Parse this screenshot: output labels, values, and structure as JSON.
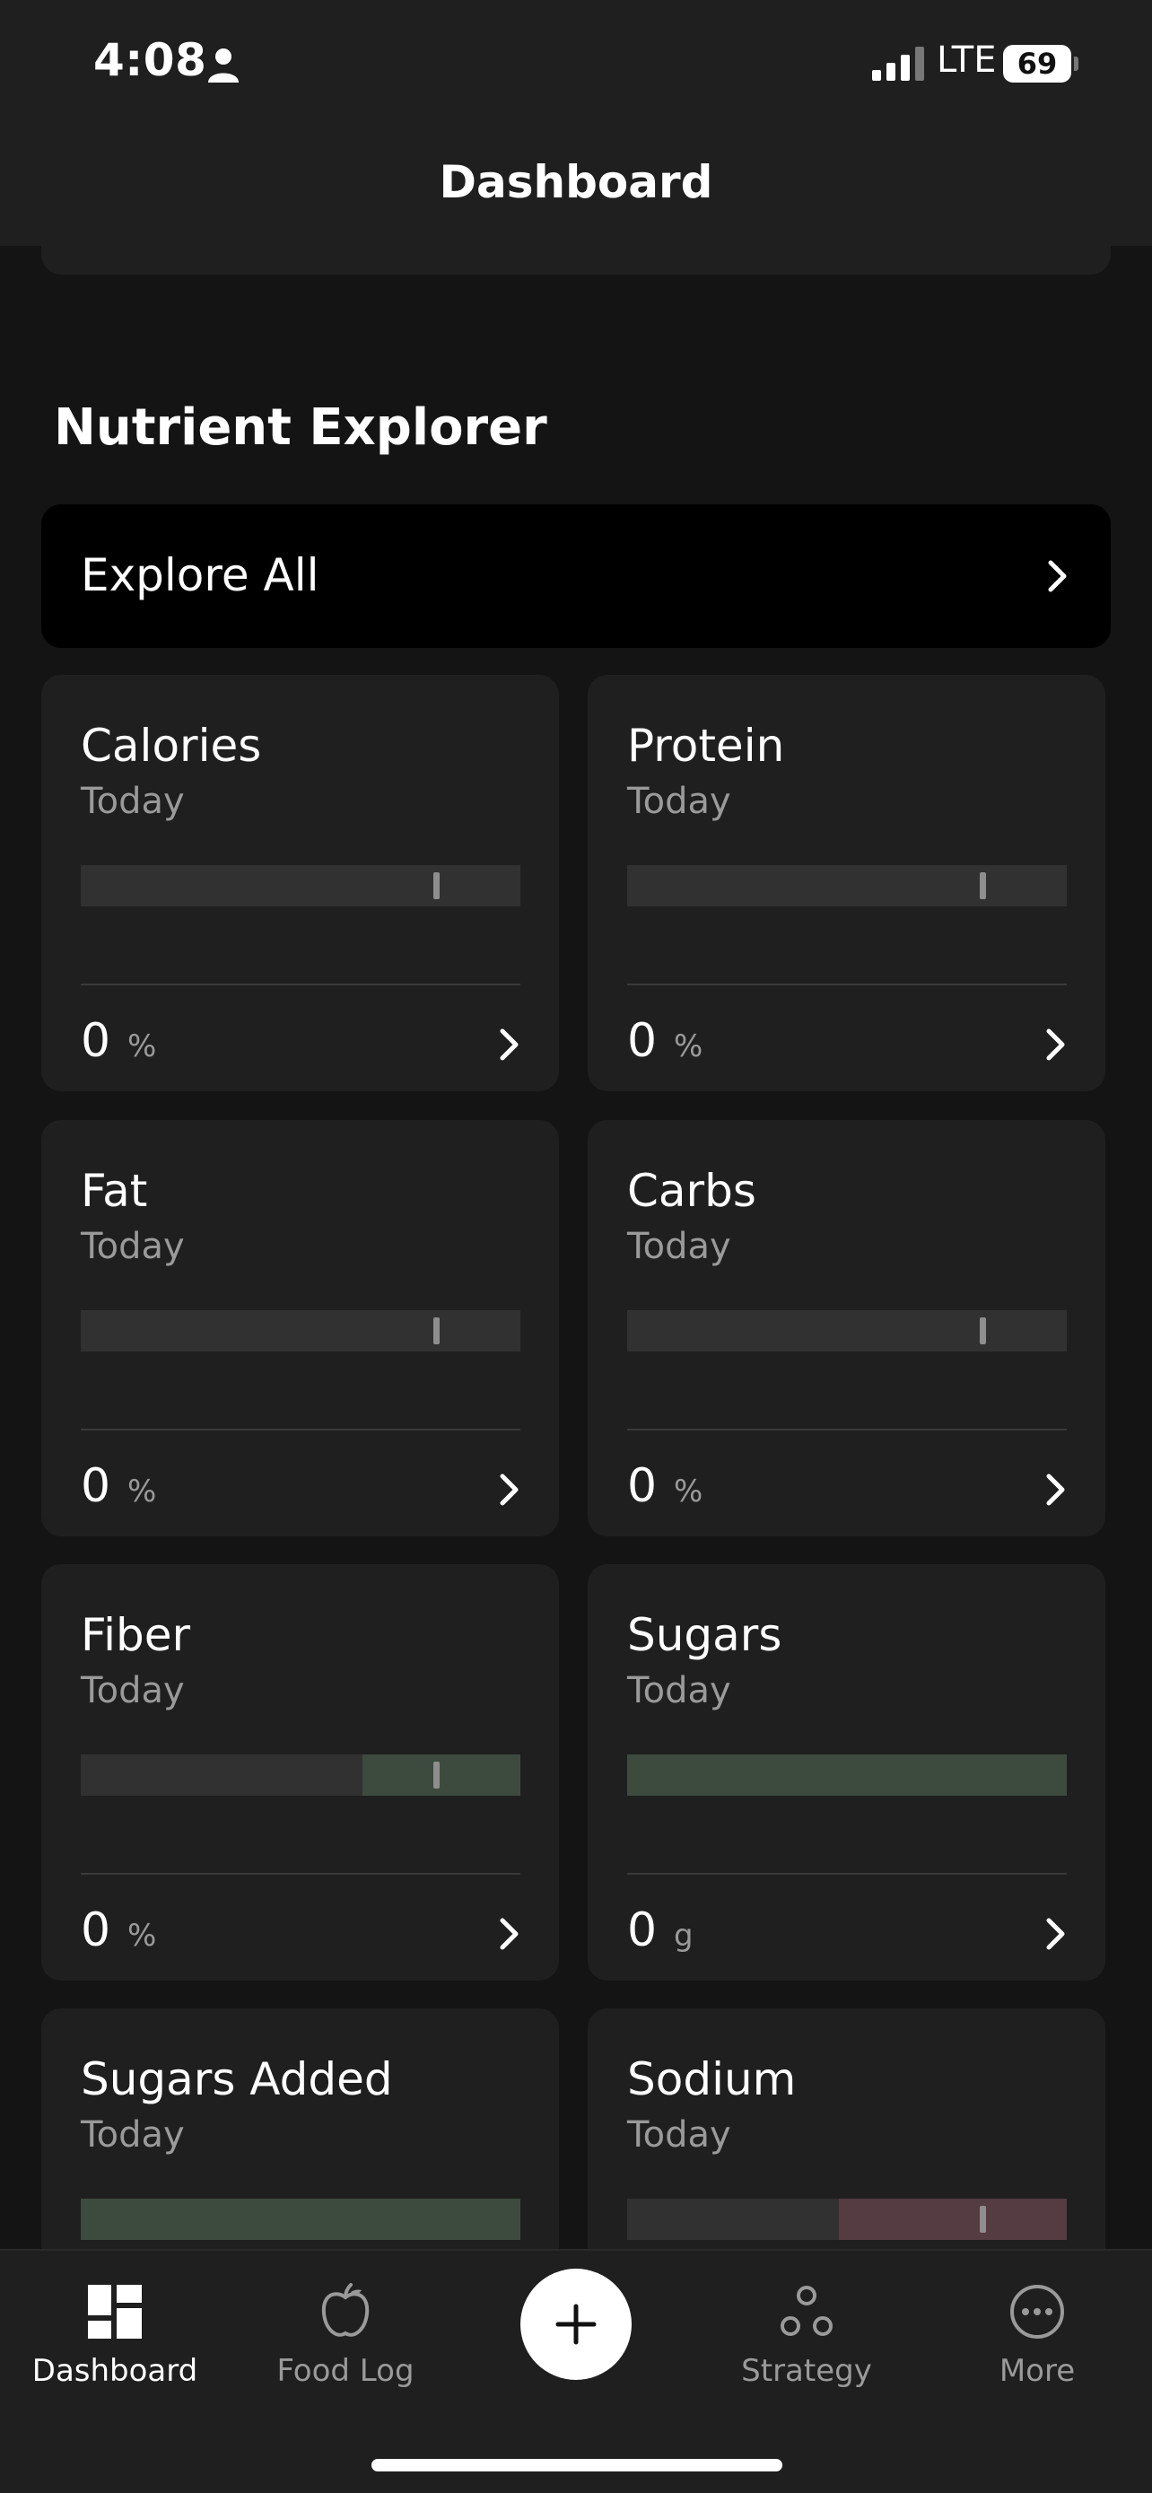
{
  "status_bar": {
    "time": "4:08",
    "network": "LTE",
    "battery": "69"
  },
  "header": {
    "title": "Dashboard"
  },
  "section": {
    "title": "Nutrient Explorer"
  },
  "explore_all": {
    "label": "Explore All"
  },
  "cards": [
    {
      "title": "Calories",
      "subtitle": "Today",
      "value": "0",
      "unit": "%"
    },
    {
      "title": "Protein",
      "subtitle": "Today",
      "value": "0",
      "unit": "%"
    },
    {
      "title": "Fat",
      "subtitle": "Today",
      "value": "0",
      "unit": "%"
    },
    {
      "title": "Carbs",
      "subtitle": "Today",
      "value": "0",
      "unit": "%"
    },
    {
      "title": "Fiber",
      "subtitle": "Today",
      "value": "0",
      "unit": "%"
    },
    {
      "title": "Sugars",
      "subtitle": "Today",
      "value": "0",
      "unit": "g"
    },
    {
      "title": "Sugars Added",
      "subtitle": "Today"
    },
    {
      "title": "Sodium",
      "subtitle": "Today"
    }
  ],
  "tabs": [
    {
      "label": "Dashboard",
      "icon": "dashboard-icon",
      "active": true
    },
    {
      "label": "Food Log",
      "icon": "apple-icon",
      "active": false
    },
    {
      "label": "Strategy",
      "icon": "strategy-icon",
      "active": false
    },
    {
      "label": "More",
      "icon": "more-icon",
      "active": false
    }
  ],
  "colors": {
    "background": "#141414",
    "card": "#1f1f1f",
    "bar_track": "#313131",
    "bar_green_zone": "#3d4b3f",
    "bar_red_zone": "#553b42"
  }
}
